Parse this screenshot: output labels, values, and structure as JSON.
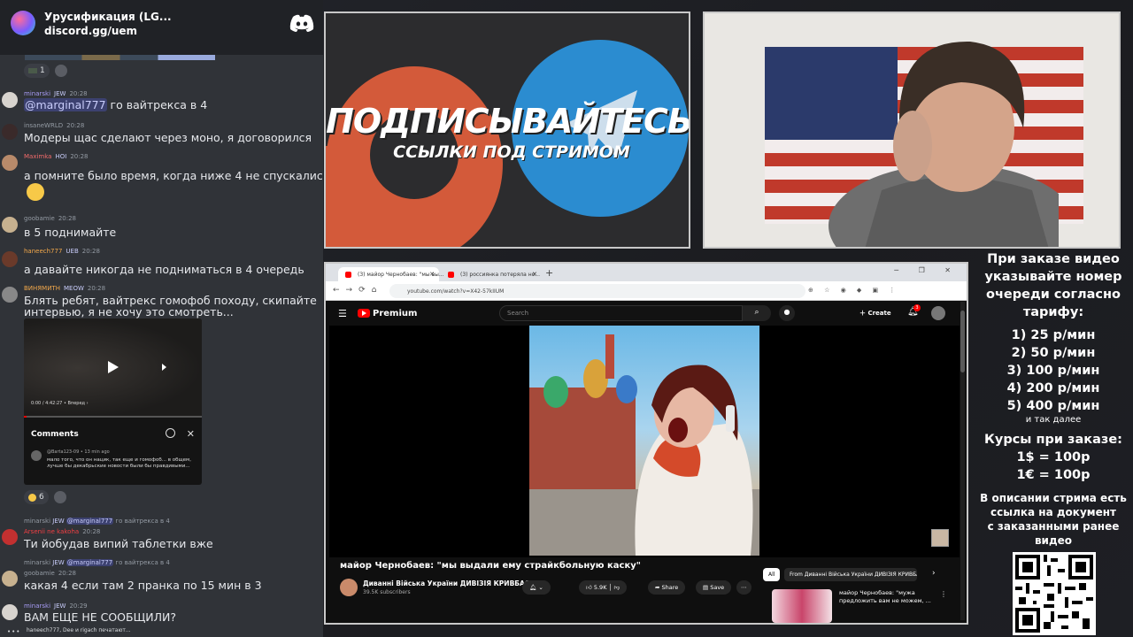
{
  "discord": {
    "server_name": "Урусификация (LG...",
    "invite": "discord.gg/uem",
    "top_reaction_count": "1",
    "messages": [
      {
        "user": "minarski",
        "tag": "JEW",
        "time": "20:28",
        "mention": "@marginal777",
        "text": " го вайтрекса в 4",
        "user_color": "#a79cf5"
      },
      {
        "user": "insaneWRLD",
        "tag": "",
        "time": "20:28",
        "text": "Модеры щас сделают через моно, я договорился",
        "user_color": "#949ba4"
      },
      {
        "user": "Maximka",
        "tag": "HOI",
        "time": "20:28",
        "text": "а помните было время, когда ниже 4 не спускались",
        "user_color": "#f26b6b"
      },
      {
        "user": "goobamie",
        "tag": "",
        "time": "20:28",
        "text": "в 5 поднимайте",
        "user_color": "#949ba4"
      },
      {
        "user": "haneech777",
        "tag": "UEB",
        "time": "20:28",
        "text": "а давайте никогда не подниматься в 4 очередь",
        "user_color": "#f2a84b"
      },
      {
        "user": "ВИНЯМИТН",
        "tag": "MEOW",
        "time": "20:28",
        "text_line1": "Блять ребят, вайтрекс гомофоб походу, скипайте",
        "text_line2": "интервью, я не хочу это смотреть...",
        "user_color": "#f2a84b"
      },
      {
        "user": "Arsenii ne kakoha",
        "tag": "",
        "time": "20:28",
        "reply_user": "minarski",
        "reply_tag": "JEW",
        "reply_mention": "@marginal777",
        "reply_text": " го вайтрекса в 4",
        "text": "Ти йобудав випий таблетки вже",
        "user_color": "#f23f43"
      },
      {
        "user": "goobamie",
        "tag": "",
        "time": "20:28",
        "reply_user": "minarski",
        "reply_tag": "JEW",
        "reply_mention": "@marginal777",
        "reply_text": " го вайтрекса в 4",
        "text": "какая 4 если там 2 пранка по 15 мин в 3",
        "user_color": "#949ba4"
      },
      {
        "user": "minarski",
        "tag": "JEW",
        "time": "20:29",
        "text": "ВАМ ЕЩЕ НЕ СООБЩИЛИ?",
        "user_color": "#a79cf5"
      }
    ],
    "embed": {
      "time": "0:00 / 4:42:27 • Вперед ›",
      "comments_label": "Comments",
      "comment_user": "@Barta123-09 • 13 min ago",
      "comment_text": "мало того, что он нацик, так еще и гомофоб... в общем, лучше бы декабрьские новости были бы правдивыми..."
    },
    "embed_reaction_count": "6",
    "typing": "haneech777, Dee и rigach печатают..."
  },
  "promo": {
    "title": "ПОДПИСЫВАЙТЕСЬ",
    "subtitle": "ССЫЛКИ ПОД СТРИМОМ"
  },
  "browser": {
    "tab1": "(3) майор Чернобаев: \"мы вы...",
    "tab2": "(3) россиянка потеряла но...",
    "url": "youtube.com/watch?v=X42-57kIIUM",
    "yt": {
      "brand": "Premium",
      "search_placeholder": "Search",
      "create": "Create",
      "notif_count": "3",
      "video_title": "майор Чернобаев: \"мы выдали ему страйкбольную каску\"",
      "channel": "Диванні Війська України ДИВІЗІЯ КРИВБАС",
      "subs": "39.5K subscribers",
      "likes": "5.9K",
      "share": "Share",
      "save": "Save",
      "chip_all": "All",
      "chip_from": "From Диванні Війська України ДИВІЗІЯ КРИВБАС",
      "rec_title": "майор Чернобаев: \"мужа предложить вам не можем, ..."
    }
  },
  "info": {
    "heading": [
      "При заказе видео",
      "указывайте номер",
      "очереди согласно",
      "тарифу:"
    ],
    "tariffs": [
      "1) 25 р/мин",
      "2) 50 р/мин",
      "3) 100 р/мин",
      "4) 200 р/мин",
      "5) 400 р/мин"
    ],
    "and_so_on": "и так далее",
    "rates_heading": "Курсы при заказе:",
    "rates": [
      "1$ = 100р",
      "1€ = 100р"
    ],
    "desc": [
      "В описании стрима есть",
      "ссылка на документ",
      "с заказанными ранее",
      "видео"
    ]
  }
}
